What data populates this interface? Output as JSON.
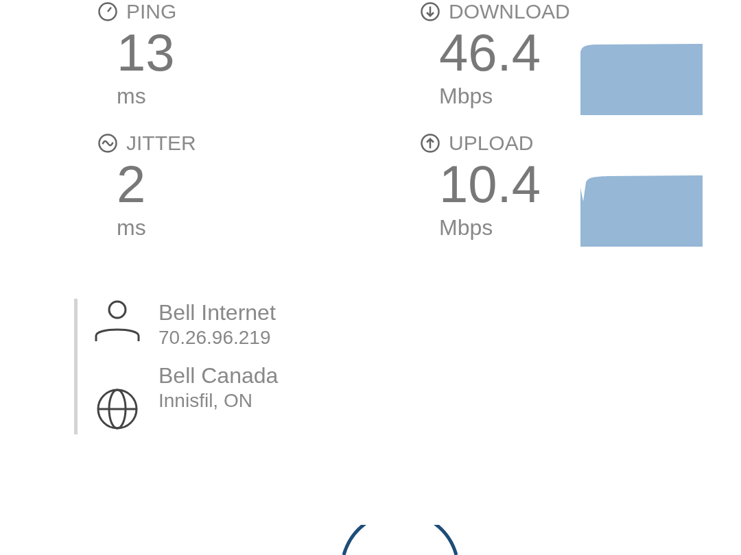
{
  "metrics": [
    {
      "kind": "ping",
      "label": "PING",
      "value": "13",
      "unit": "ms"
    },
    {
      "kind": "download",
      "label": "DOWNLOAD",
      "value": "46.4",
      "unit": "Mbps"
    },
    {
      "kind": "jitter",
      "label": "JITTER",
      "value": "2",
      "unit": "ms"
    },
    {
      "kind": "upload",
      "label": "UPLOAD",
      "value": "10.4",
      "unit": "Mbps"
    }
  ],
  "connection": [
    {
      "kind": "provider",
      "name": "Bell Internet",
      "detail": "70.26.96.219"
    },
    {
      "kind": "server",
      "name": "Bell Canada",
      "detail": "Innisfil, ON"
    }
  ]
}
